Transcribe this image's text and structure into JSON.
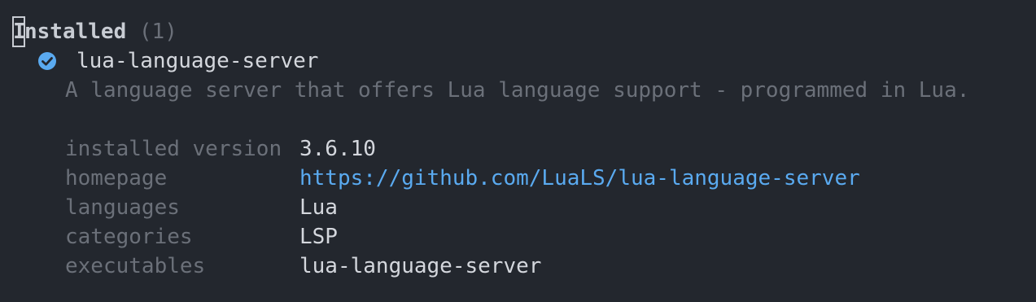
{
  "header": {
    "first_letter": "I",
    "title_rest": "nstalled",
    "count": "(1)"
  },
  "package": {
    "icon": "check-circle-icon",
    "name": "lua-language-server",
    "description": "A language server that offers Lua language support - programmed in Lua."
  },
  "details": [
    {
      "key": "installed version",
      "value": "3.6.10"
    },
    {
      "key": "homepage",
      "value": "https://github.com/LuaLS/lua-language-server"
    },
    {
      "key": "languages",
      "value": "Lua"
    },
    {
      "key": "categories",
      "value": "LSP"
    },
    {
      "key": "executables",
      "value": "lua-language-server"
    }
  ],
  "colors": {
    "background": "#23272e",
    "text": "#d4d7dd",
    "muted": "#6b7079",
    "link": "#5aaaf0",
    "check": "#5aaaf0"
  }
}
